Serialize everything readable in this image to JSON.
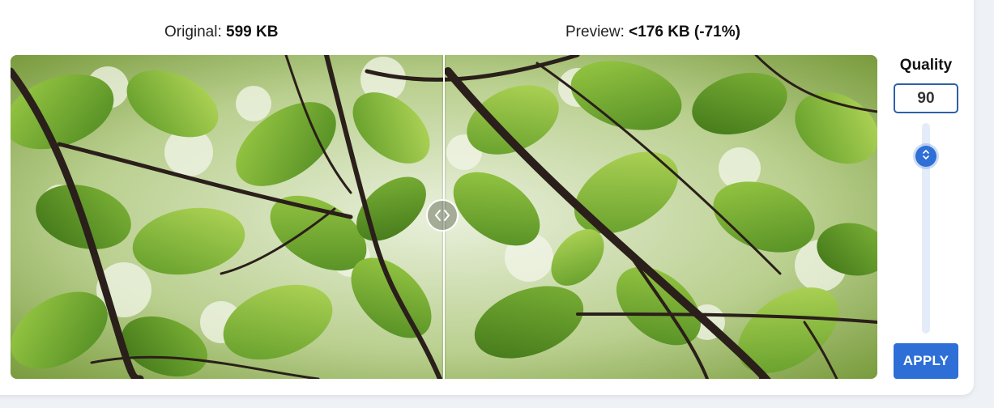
{
  "labels": {
    "original_prefix": "Original:",
    "original_size": "599 KB",
    "preview_prefix": "Preview:",
    "preview_size": "<176 KB (-71%)"
  },
  "quality": {
    "title": "Quality",
    "value": "90",
    "level_percent": 90
  },
  "apply_label": "APPLY",
  "icons": {
    "compare_handle": "chevron-left-right-icon",
    "slider_thumb": "chevron-up-down-icon"
  },
  "colors": {
    "accent": "#2d6fd7",
    "input_border": "#2f5fa8",
    "leaf_green": "#6e9a2c",
    "branch": "#2a1f1a"
  }
}
